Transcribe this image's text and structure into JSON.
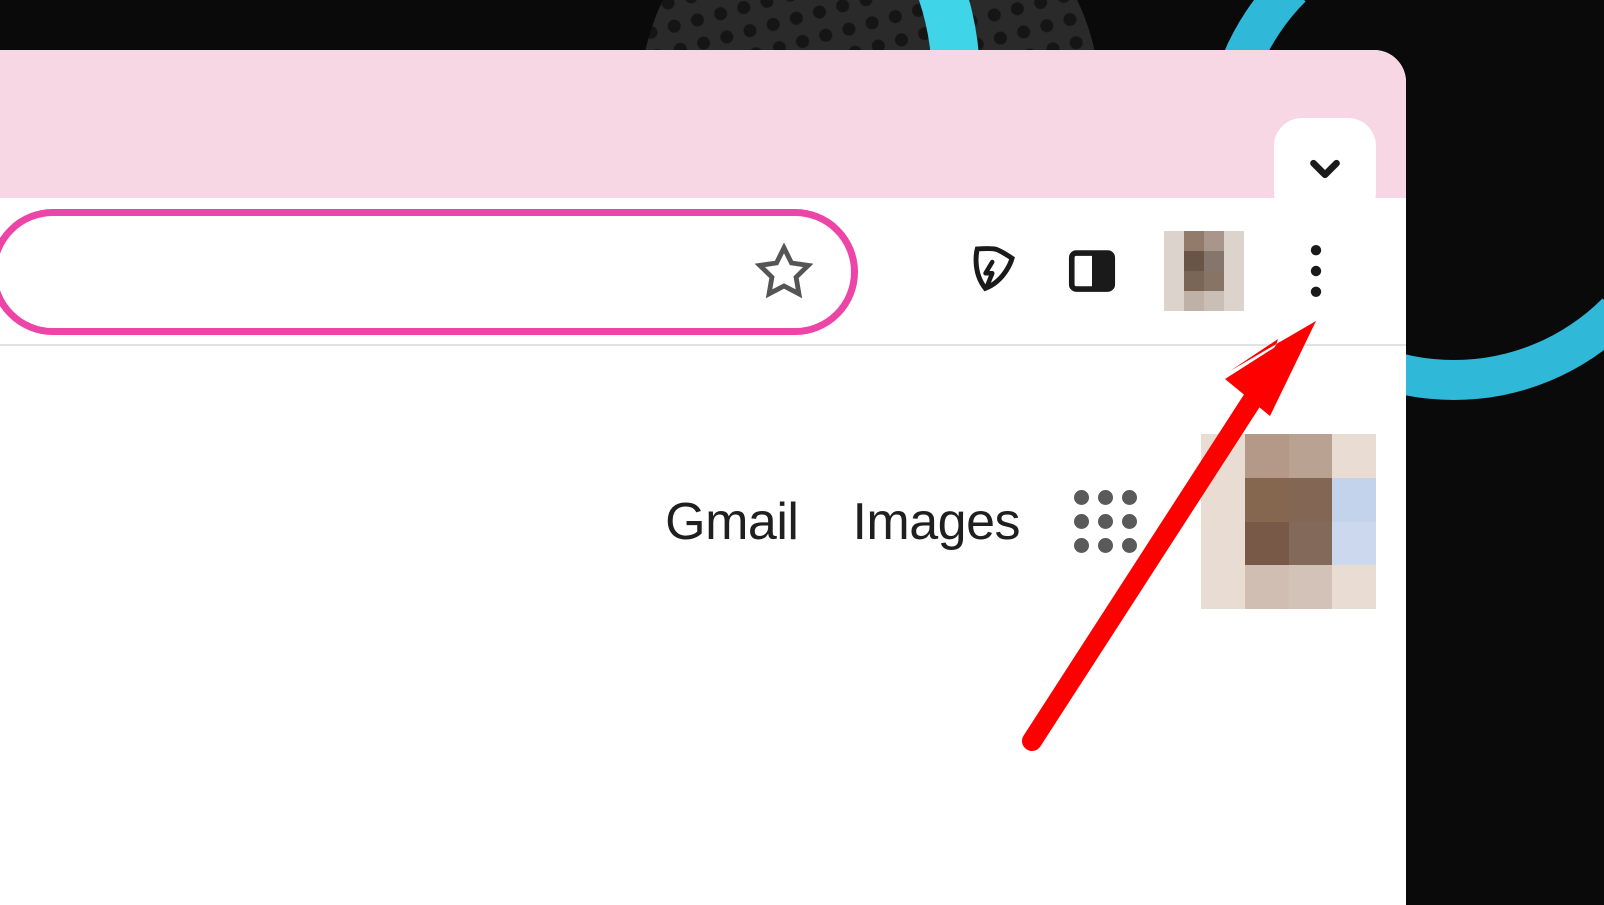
{
  "tab_strip": {
    "theme_color": "#f7d7e3",
    "accent_color": "#ec44a7"
  },
  "toolbar": {
    "bookmark_icon": "star-outline",
    "extension_icon": "leaf-lightning",
    "side_panel_icon": "panel-toggle",
    "profile_avatar": "pixelated-avatar",
    "menu_icon": "more-vertical"
  },
  "content": {
    "links": {
      "gmail": "Gmail",
      "images": "Images"
    },
    "apps_icon": "apps-grid",
    "account_avatar": "pixelated-avatar"
  },
  "annotation": {
    "arrow_color": "#ff0000",
    "points_to": "more-menu-button"
  }
}
